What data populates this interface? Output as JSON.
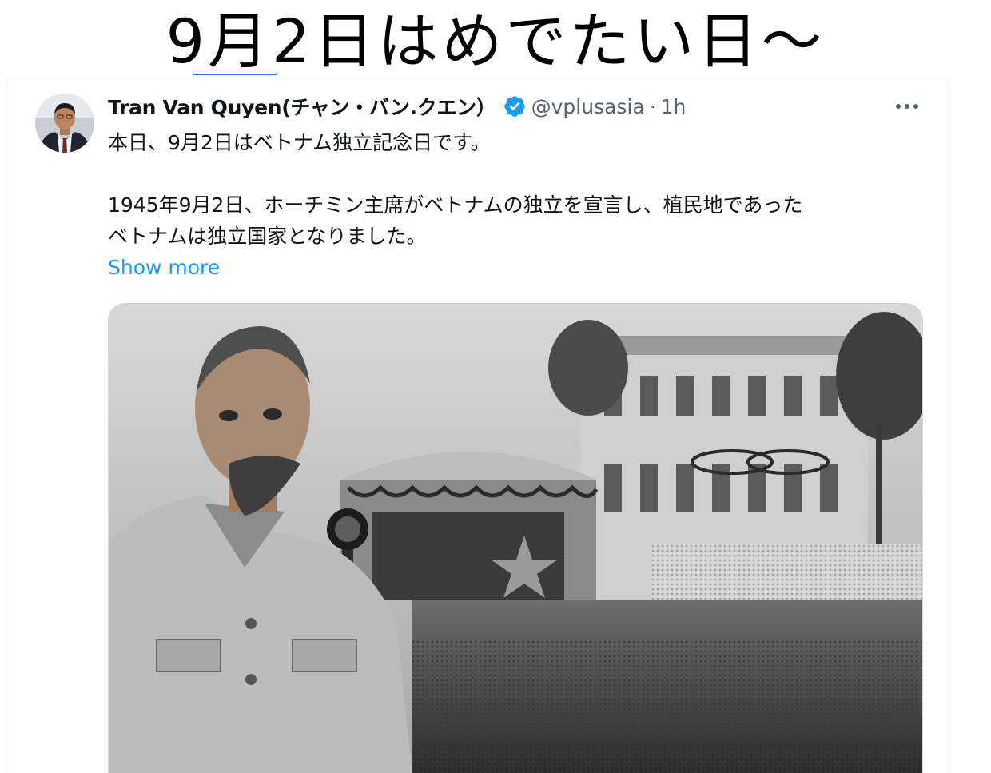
{
  "slide": {
    "title": "9月2日はめでたい日～"
  },
  "tweet": {
    "author": {
      "display_name": "Tran Van Quyen(チャン・バン.クエン）",
      "handle": "@vplusasia",
      "verified": true
    },
    "separator": "·",
    "timestamp": "1h",
    "text_line1": "本日、9月2日はベトナム独立記念日です。",
    "text_line2": "1945年9月2日、ホーチミン主席がベトナムの独立を宣言し、植民地であった",
    "text_line3": "ベトナムは独立国家となりました。",
    "show_more_label": "Show more"
  },
  "icons": {
    "verified": "verified-badge-icon",
    "more": "more-horizontal-icon"
  },
  "colors": {
    "text_primary": "#0f1419",
    "text_secondary": "#536471",
    "link": "#1d9bf0",
    "verified_badge": "#1d9bf0"
  }
}
